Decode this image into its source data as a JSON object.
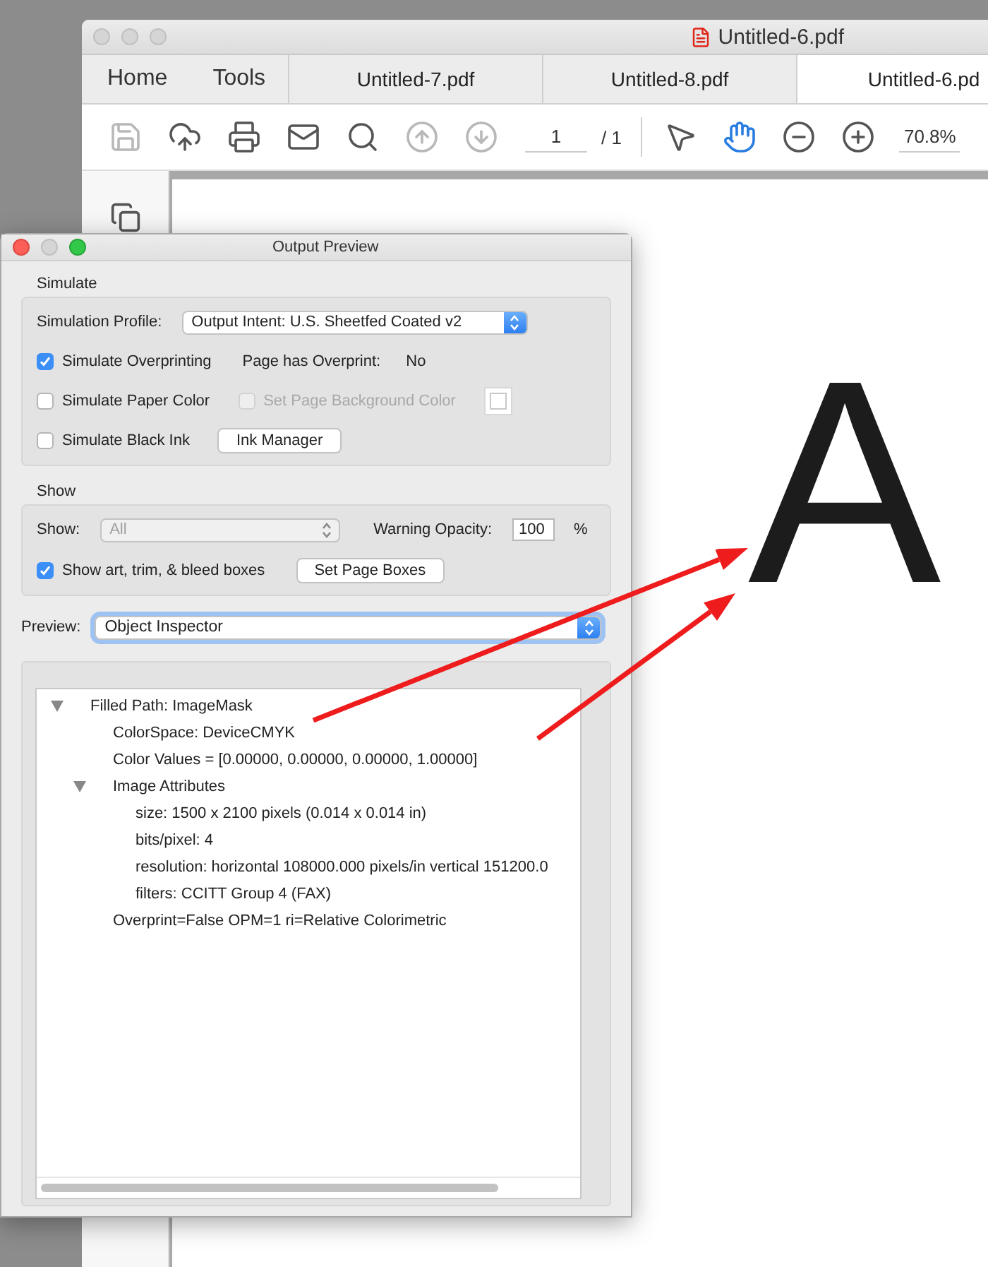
{
  "app_window": {
    "title": "Untitled-6.pdf",
    "tabs": [
      {
        "label": "Home",
        "kind": "nav",
        "selected": false
      },
      {
        "label": "Tools",
        "kind": "nav",
        "selected": false
      },
      {
        "label": "Untitled-7.pdf",
        "kind": "doc",
        "selected": false
      },
      {
        "label": "Untitled-8.pdf",
        "kind": "doc",
        "selected": false
      },
      {
        "label": "Untitled-6.pd",
        "kind": "doc",
        "selected": true
      }
    ],
    "toolbar": {
      "left_buttons": [
        {
          "kind": "save",
          "disabled": true
        },
        {
          "kind": "upload",
          "disabled": false
        },
        {
          "kind": "print",
          "disabled": false
        },
        {
          "kind": "mail",
          "disabled": false
        },
        {
          "kind": "search",
          "disabled": false
        },
        {
          "kind": "previous",
          "disabled": true
        },
        {
          "kind": "next",
          "disabled": true
        }
      ],
      "page_field": {
        "value": "1"
      },
      "page_total": "/ 1",
      "right_buttons": [
        {
          "kind": "pointer",
          "selected": false
        },
        {
          "kind": "hand",
          "selected": true
        },
        {
          "kind": "zoom-out",
          "selected": false
        },
        {
          "kind": "zoom-in",
          "selected": false
        }
      ],
      "zoom_field": {
        "value": "70.8%"
      }
    },
    "document": {
      "letter": "A"
    }
  },
  "output_preview": {
    "title": "Output Preview",
    "simulate": {
      "heading": "Simulate",
      "profile_label": "Simulation Profile:",
      "profile_value": "Output Intent: U.S. Sheetfed Coated v2",
      "overprinting": {
        "label": "Simulate Overprinting",
        "checked": true
      },
      "page_overprint_label": "Page has Overprint:",
      "page_overprint_value": "No",
      "paper_color": {
        "label": "Simulate Paper Color",
        "checked": false
      },
      "page_background": {
        "label": "Set Page Background Color",
        "checked": false,
        "disabled": true
      },
      "black_ink": {
        "label": "Simulate Black Ink",
        "checked": false
      },
      "ink_manager_button": "Ink Manager"
    },
    "show": {
      "heading": "Show",
      "show_label": "Show:",
      "show_select": {
        "value": "All",
        "disabled": true
      },
      "opacity_label": "Warning Opacity:",
      "opacity_value": "100",
      "percent": "%",
      "boxes": {
        "label": "Show art, trim, & bleed boxes",
        "checked": true
      },
      "page_boxes_button": "Set Page Boxes"
    },
    "preview": {
      "label": "Preview:",
      "value": "Object Inspector"
    },
    "inspector_tree": [
      {
        "label": "Filled Path: ImageMask",
        "expanded": true,
        "children": [
          {
            "label": "ColorSpace: DeviceCMYK"
          },
          {
            "label": "Color Values = [0.00000, 0.00000, 0.00000, 1.00000]"
          },
          {
            "label": "Image Attributes",
            "expanded": true,
            "children": [
              {
                "label": "size: 1500 x 2100 pixels (0.014 x 0.014 in)"
              },
              {
                "label": "bits/pixel: 4"
              },
              {
                "label": "resolution: horizontal 108000.000 pixels/in vertical 151200.0"
              },
              {
                "label": "filters: CCITT Group 4 (FAX)"
              }
            ]
          },
          {
            "label": "Overprint=False OPM=1 ri=Relative Colorimetric"
          }
        ]
      }
    ]
  }
}
